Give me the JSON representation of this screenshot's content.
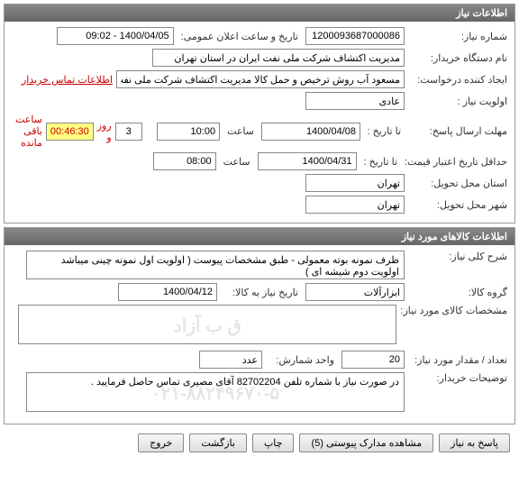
{
  "info_panel": {
    "title": "اطلاعات نیاز",
    "need_number_label": "شماره نیاز:",
    "need_number": "1200093687000086",
    "announce_label": "تاریخ و ساعت اعلان عمومی:",
    "announce_value": "1400/04/05 - 09:02",
    "buyer_org_label": "نام دستگاه خریدار:",
    "buyer_org": "مدیریت اکتشاف شرکت ملی نفت ایران در استان تهران",
    "creator_label": "ایجاد کننده درخواست:",
    "creator": "مسعود آب روش ترخیص و حمل کالا مدیریت اکتشاف شرکت ملی نفت ایران در اس",
    "contact_link": "اطلاعات تماس خریدار",
    "priority_label": "اولویت نیاز :",
    "priority": "عادی",
    "deadline_label": "مهلت ارسال پاسخ:",
    "to_date_label": "تا تاریخ :",
    "deadline_date": "1400/04/08",
    "time_label": "ساعت",
    "deadline_time": "10:00",
    "days_value": "3",
    "days_unit": "روز و",
    "countdown": "00:46:30",
    "remaining_label": "ساعت باقی مانده",
    "min_credit_label": "حداقل تاریخ اعتبار قیمت:",
    "credit_date": "1400/04/31",
    "credit_time": "08:00",
    "province_label": "استان محل تحویل:",
    "province": "تهران",
    "city_label": "شهر محل تحویل:",
    "city": "تهران"
  },
  "goods_panel": {
    "title": "اطلاعات کالاهای مورد نیاز",
    "desc_label": "شرح کلی نیاز:",
    "desc": "ظرف نمونه بوته معمولی - طبق مشخصات پیوست ( اولویت اول نمونه چینی میباشد اولویت دوم شیشه ای )",
    "group_label": "گروه کالا:",
    "group": "ابزارآلات",
    "need_date_label": "تاریخ نیاز به کالا:",
    "need_date": "1400/04/12",
    "specs_label": "مشخصات کالای مورد نیاز:",
    "specs": "",
    "watermark1": "ق ب آزاد",
    "qty_label": "تعداد / مقدار مورد نیاز:",
    "qty": "20",
    "unit_label": "واحد شمارش:",
    "unit": "عدد",
    "notes_label": "توضیحات خریدار:",
    "notes": "در صورت نیاز با شماره تلفن 82702204 آقای مصیری تماس حاصل فرمایید .",
    "watermark2": "۰۲۱-۸۸۲۴۹۶۷۰-۵"
  },
  "footer": {
    "reply": "پاسخ به نیاز",
    "attachments": "مشاهده مدارک پیوستی (5)",
    "print": "چاپ",
    "back": "بازگشت",
    "exit": "خروج"
  }
}
